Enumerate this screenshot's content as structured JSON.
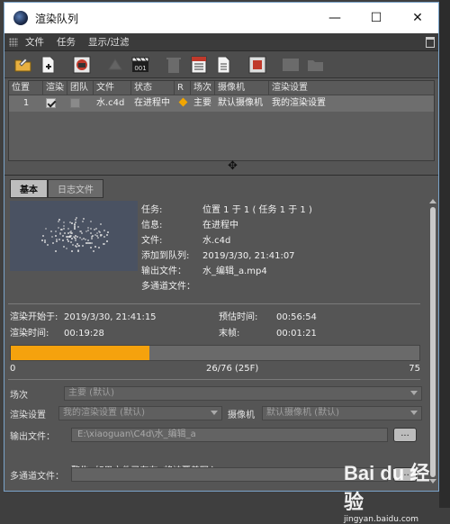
{
  "window": {
    "title": "渲染队列"
  },
  "menu": [
    "文件",
    "任务",
    "显示/过滤"
  ],
  "queue": {
    "columns": [
      "位置",
      "渲染",
      "团队",
      "文件",
      "状态",
      "R",
      "场次",
      "摄像机",
      "渲染设置"
    ],
    "rows": [
      {
        "position": "1",
        "render": true,
        "team": false,
        "file": "水.c4d",
        "status": "在进程中",
        "take": "主要",
        "camera": "默认摄像机",
        "settings": "我的渲染设置"
      }
    ]
  },
  "tabs": [
    "基本",
    "日志文件"
  ],
  "info": {
    "task_label": "任务:",
    "task_value": "位置 1 于 1 ( 任务 1 于 1 )",
    "message_label": "信息:",
    "message_value": "在进程中",
    "file_label": "文件:",
    "file_value": "水.c4d",
    "added_label": "添加到队列:",
    "added_value": "2019/3/30, 21:41:07",
    "output_label": "输出文件：",
    "output_value": "水_编辑_a.mp4",
    "multipass_label": "多通道文件："
  },
  "timing": {
    "start_label": "渲染开始于:",
    "start_value": "2019/3/30, 21:41:15",
    "estimate_label": "预估时间:",
    "estimate_value": "00:56:54",
    "render_time_label": "渲染时间:",
    "render_time_value": "00:19:28",
    "last_frame_label": "末帧:",
    "last_frame_value": "00:01:21"
  },
  "progress": {
    "min": "0",
    "max": "75",
    "status": "26/76 (25F)",
    "fraction": 0.34,
    "color": "#f5a20d"
  },
  "form": {
    "take_label": "场次",
    "take_value": "主要 (默认)",
    "render_settings_label": "渲染设置",
    "render_settings_value": "我的渲染设置 (默认)",
    "camera_label": "摄像机",
    "camera_value": "默认摄像机 (默认)",
    "output_label": "输出文件：",
    "output_value": "E:\\xiaoguan\\C4d\\水_编辑_a",
    "browse_label": "...",
    "warning": "警告: 如果文件已存在, 将被覆盖写入.",
    "multipass_label": "多通道文件：",
    "multipass_browse": "..."
  },
  "watermark": {
    "logo": "Bai du 经验",
    "url": "jingyan.baidu.com"
  }
}
